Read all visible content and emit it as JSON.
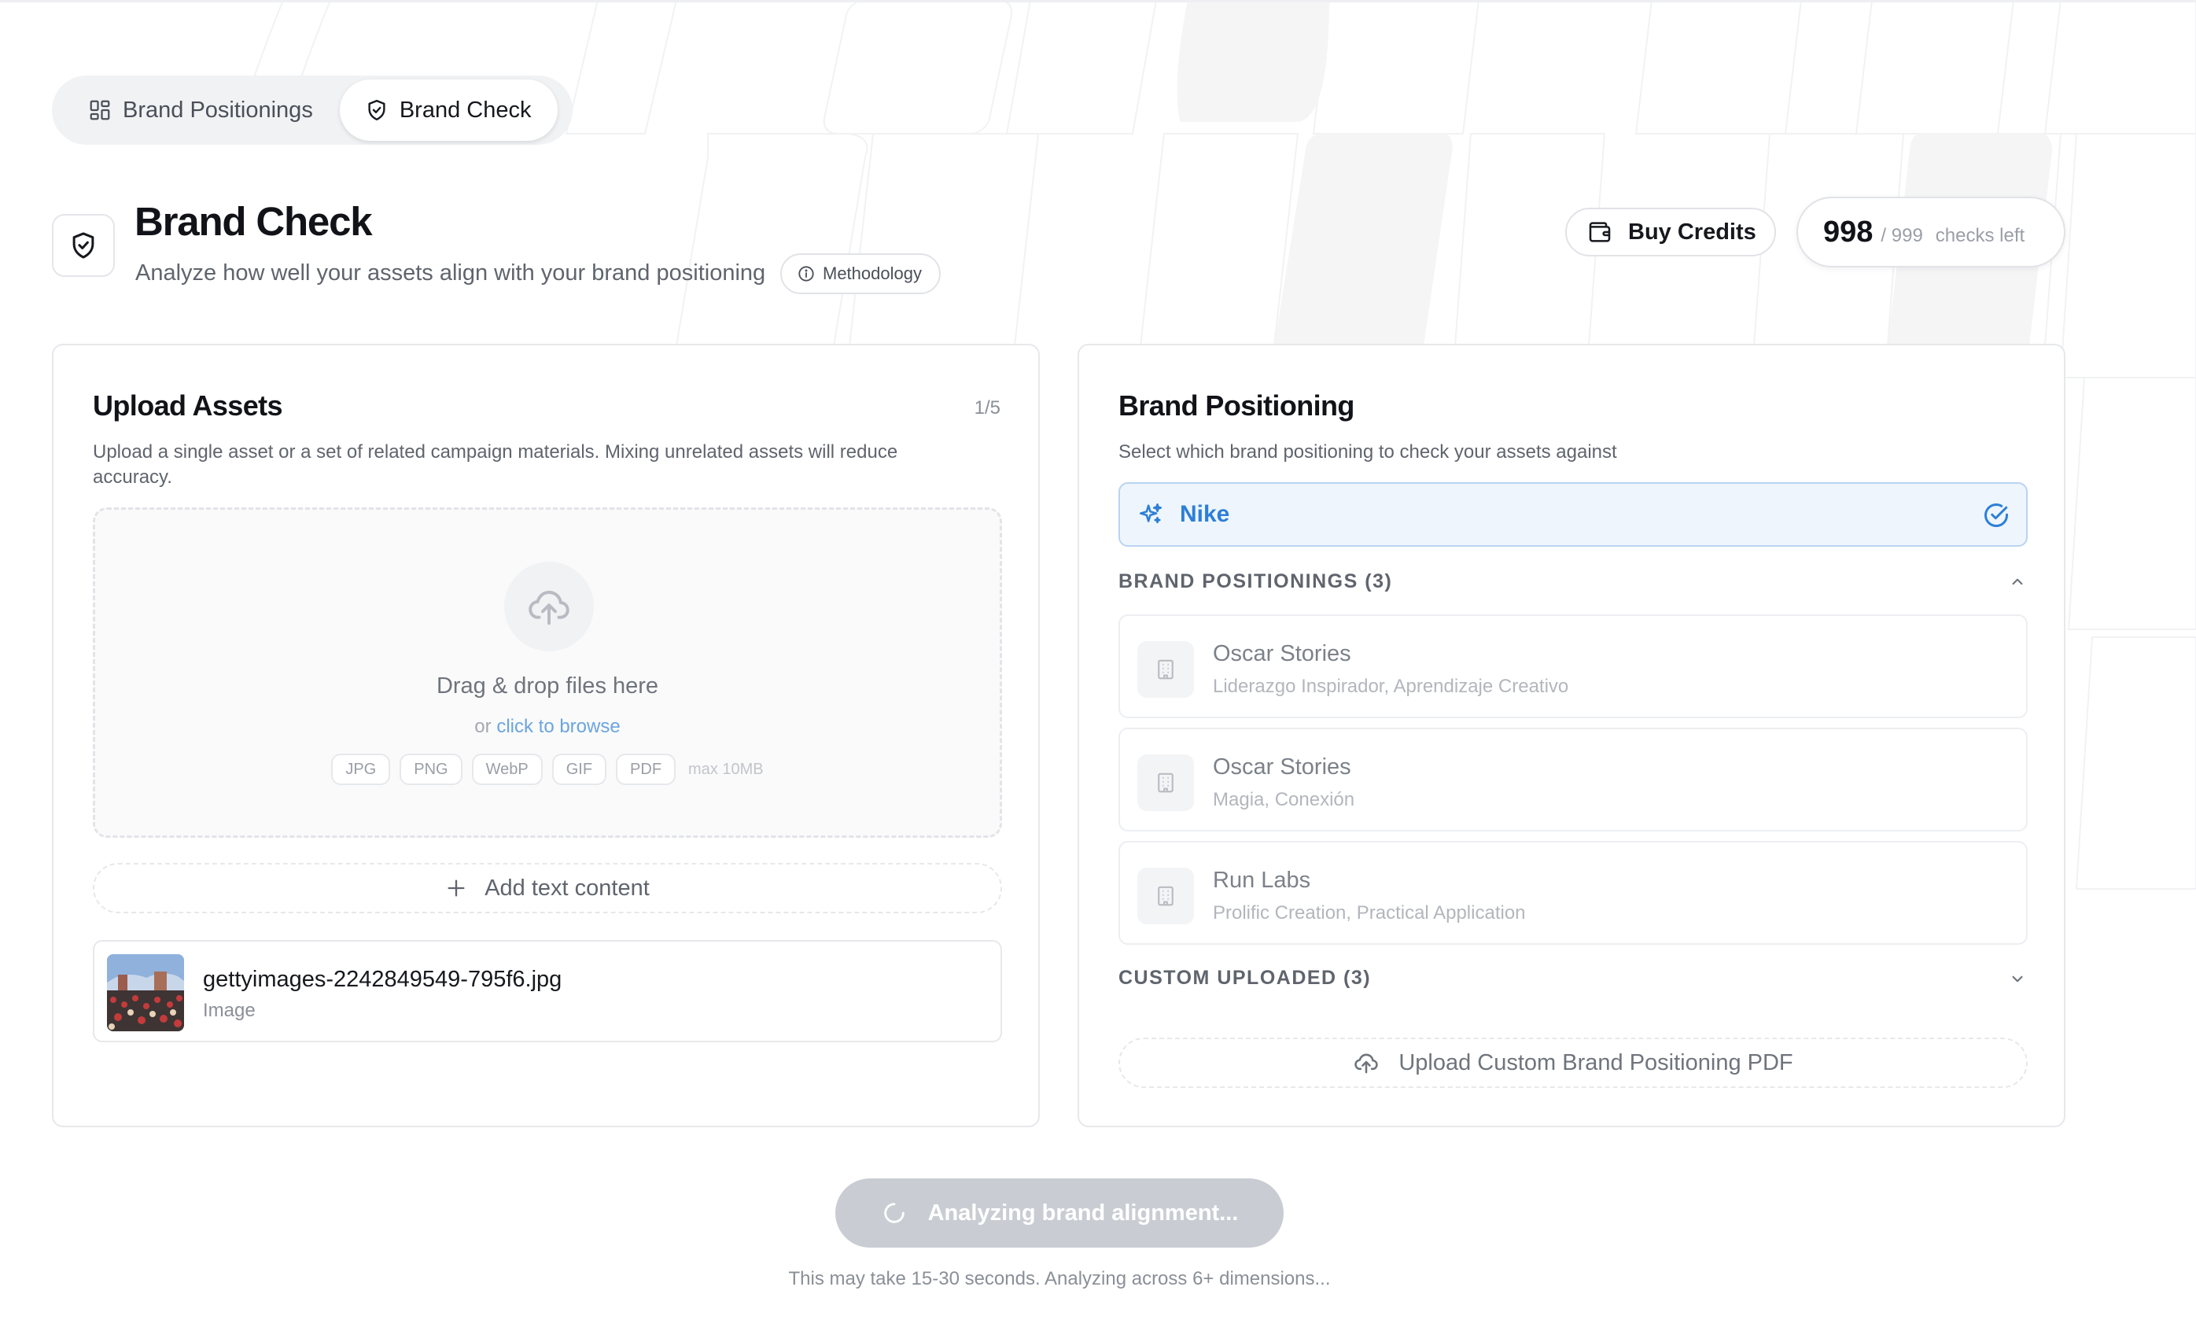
{
  "tabs": [
    {
      "label": "Brand Positionings",
      "icon": "grid-icon",
      "active": false
    },
    {
      "label": "Brand Check",
      "icon": "shield-check-icon",
      "active": true
    }
  ],
  "header": {
    "title": "Brand Check",
    "subtitle": "Analyze how well your assets align with your brand positioning",
    "methodology_label": "Methodology",
    "buy_credits_label": "Buy Credits",
    "credits": {
      "used": "998",
      "total": "/ 999",
      "label": "checks left"
    }
  },
  "upload": {
    "title": "Upload Assets",
    "count": "1/5",
    "description": "Upload a single asset or a set of related campaign materials. Mixing unrelated assets will reduce accuracy.",
    "dropzone": {
      "title": "Drag & drop files here",
      "or_text": "or",
      "browse_label": "click to browse",
      "formats": [
        "JPG",
        "PNG",
        "WebP",
        "GIF",
        "PDF"
      ],
      "max_size": "max 10MB"
    },
    "add_text_label": "Add text content",
    "files": [
      {
        "name": "gettyimages-2242849549-795f6.jpg",
        "type": "Image"
      }
    ]
  },
  "brand": {
    "title": "Brand Positioning",
    "description": "Select which brand positioning to check your assets against",
    "selected": "Nike",
    "positionings_header": "BRAND POSITIONINGS (3)",
    "positionings": [
      {
        "name": "Oscar Stories",
        "tags": "Liderazgo Inspirador, Aprendizaje Creativo"
      },
      {
        "name": "Oscar Stories",
        "tags": "Magia, Conexión"
      },
      {
        "name": "Run Labs",
        "tags": "Prolific Creation, Practical Application"
      }
    ],
    "custom_header": "CUSTOM UPLOADED (3)",
    "upload_pdf_label": "Upload Custom Brand Positioning PDF"
  },
  "analyze": {
    "button_label": "Analyzing brand alignment...",
    "note": "This may take 15-30 seconds. Analyzing across 6+ dimensions..."
  },
  "colors": {
    "accent": "#2d7fd6",
    "selected_bg": "#eef5fd",
    "button_disabled": "#c9cdd3"
  }
}
